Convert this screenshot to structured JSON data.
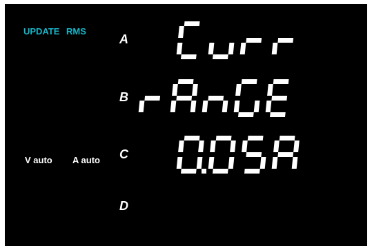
{
  "colors": {
    "background": "#000000",
    "indicator": "#18b4c8",
    "label": "#ffffff",
    "segment": "#ffffff"
  },
  "indicators": {
    "update": "UPDATE",
    "rms": "RMS"
  },
  "range_status": {
    "voltage": "V auto",
    "current": "A auto"
  },
  "rows": [
    {
      "letter": "A",
      "text": "Curr"
    },
    {
      "letter": "B",
      "text": "rAnGE"
    },
    {
      "letter": "C",
      "text": "0.05A"
    },
    {
      "letter": "D",
      "text": ""
    }
  ]
}
